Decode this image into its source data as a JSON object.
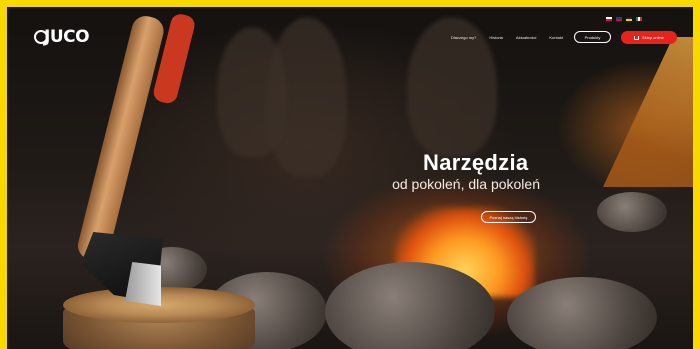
{
  "brand": {
    "logo_text": "JUCO"
  },
  "flags": [
    {
      "name": "flag-pl",
      "color_top": "#ffffff",
      "color_bottom": "#dc143c"
    },
    {
      "name": "flag-uk",
      "color_top": "#1f3f8c",
      "color_bottom": "#c8102e"
    },
    {
      "name": "flag-de",
      "color_top": "#222222",
      "color_bottom": "#ffce00"
    },
    {
      "name": "flag-it",
      "color_top": "#009246",
      "color_bottom": "#ce2b37"
    }
  ],
  "nav": {
    "items": [
      "Dlaczego my?",
      "Historia",
      "Aktualności",
      "Kontakt"
    ],
    "products_label": "Produkty",
    "store_label": "Sklep online"
  },
  "hero": {
    "title": "Narzędzia",
    "subtitle": "od pokoleń, dla pokoleń",
    "button_label": "Poznaj naszą historię"
  },
  "colors": {
    "accent_red": "#e8231b",
    "frame_yellow": "#f7d900"
  }
}
